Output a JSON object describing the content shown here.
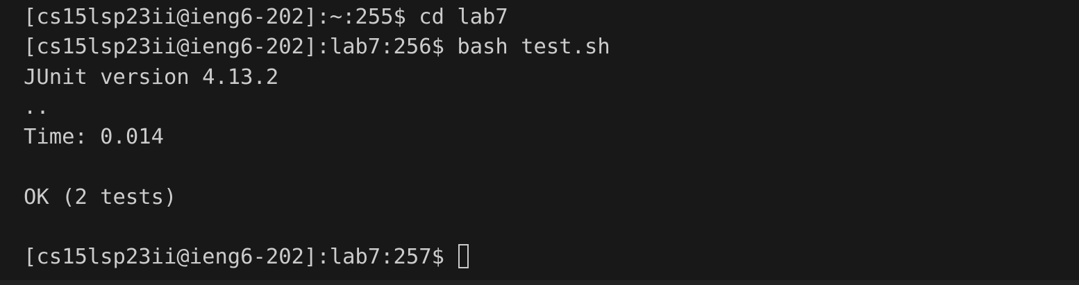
{
  "terminal": {
    "background_color": "#181818",
    "text_color": "#cccccc",
    "lines": [
      "[cs15lsp23ii@ieng6-202]:~:255$ cd lab7",
      "[cs15lsp23ii@ieng6-202]:lab7:256$ bash test.sh",
      "JUnit version 4.13.2",
      "..",
      "Time: 0.014",
      "",
      "OK (2 tests)",
      ""
    ],
    "prompt": "[cs15lsp23ii@ieng6-202]:lab7:257$"
  }
}
